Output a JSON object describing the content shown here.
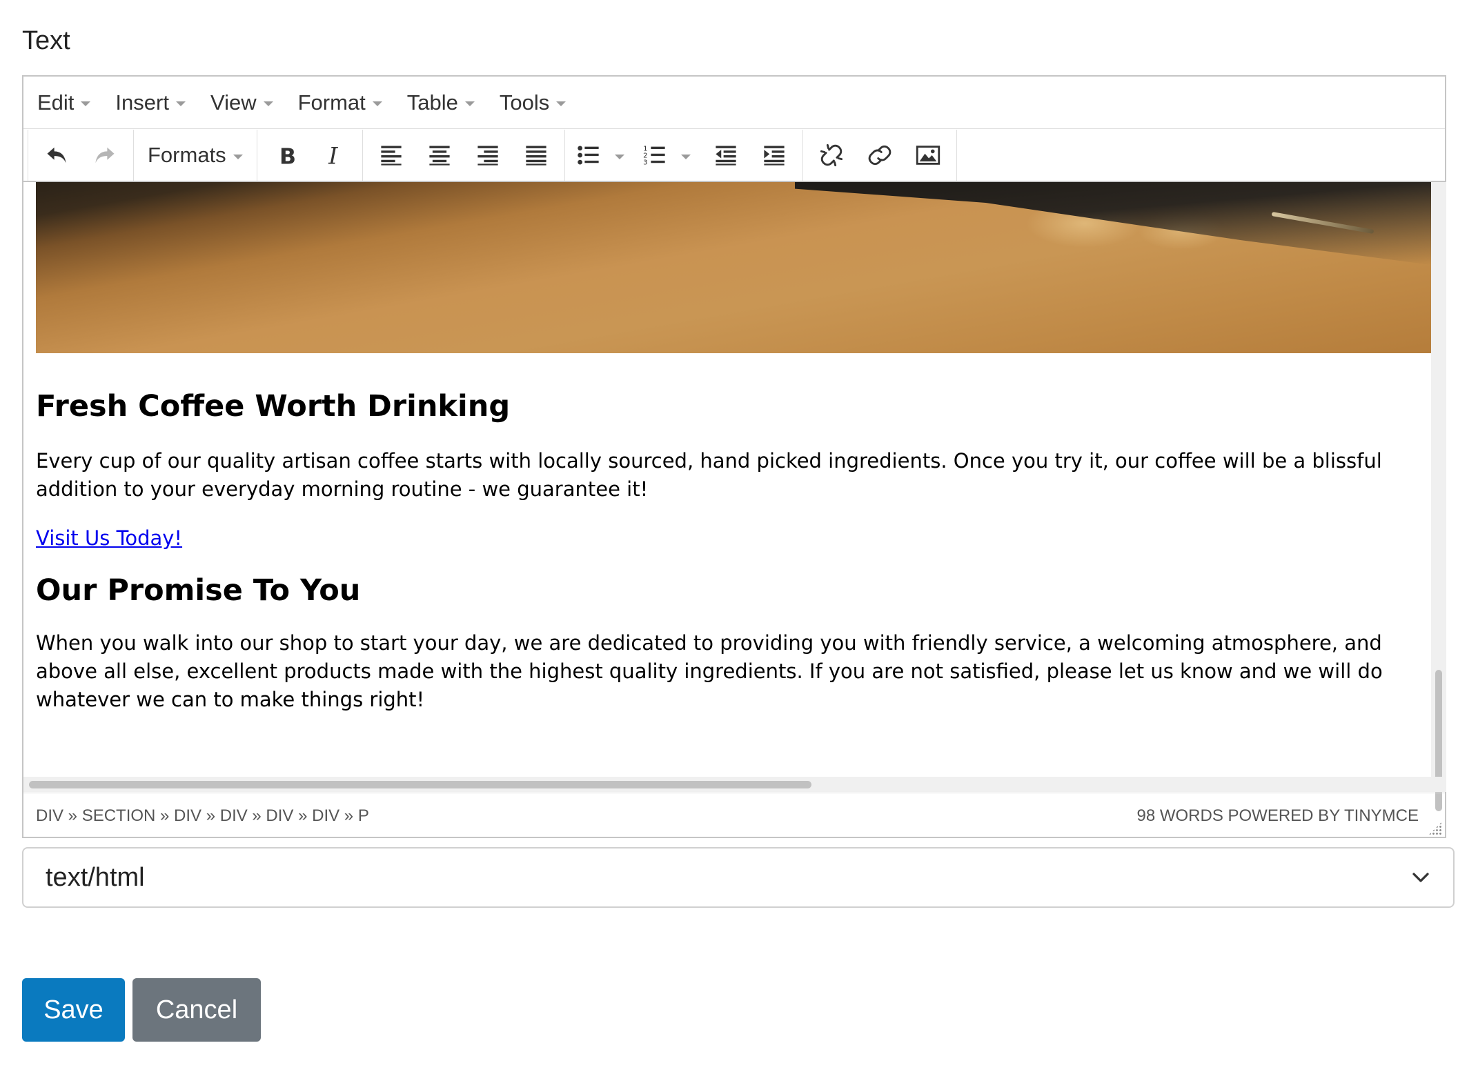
{
  "field": {
    "label": "Text"
  },
  "menubar": {
    "items": [
      {
        "label": "Edit"
      },
      {
        "label": "Insert"
      },
      {
        "label": "View"
      },
      {
        "label": "Format"
      },
      {
        "label": "Table"
      },
      {
        "label": "Tools"
      }
    ]
  },
  "toolbar": {
    "formats_label": "Formats",
    "icons": [
      "undo-icon",
      "redo-icon",
      "bold-icon",
      "italic-icon",
      "align-left-icon",
      "align-center-icon",
      "align-right-icon",
      "align-justify-icon",
      "bullet-list-icon",
      "numbered-list-icon",
      "outdent-icon",
      "indent-icon",
      "unlink-icon",
      "link-icon",
      "image-icon"
    ]
  },
  "content": {
    "heading1": "Fresh Coffee Worth Drinking",
    "para1": "Every cup of our quality artisan coffee starts with locally sourced, hand picked ingredients. Once you try it, our coffee will be a blissful addition to your everyday morning routine - we guarantee it!",
    "link": "Visit Us Today!",
    "heading2": "Our Promise To You",
    "para2": "When you walk into our shop to start your day, we are dedicated to providing you with friendly service, a welcoming atmosphere, and above all else, excellent products made with the highest quality ingredients. If you are not satisfied, please let us know and we will do whatever we can to make things right!"
  },
  "statusbar": {
    "path": "DIV » SECTION » DIV » DIV » DIV » DIV » P",
    "wordcount": "98 WORDS POWERED BY TINYMCE"
  },
  "format_select": {
    "value": "text/html"
  },
  "buttons": {
    "save": "Save",
    "cancel": "Cancel"
  },
  "colors": {
    "save": "#0a7abf",
    "cancel": "#6c757d",
    "link": "#0000ee"
  }
}
